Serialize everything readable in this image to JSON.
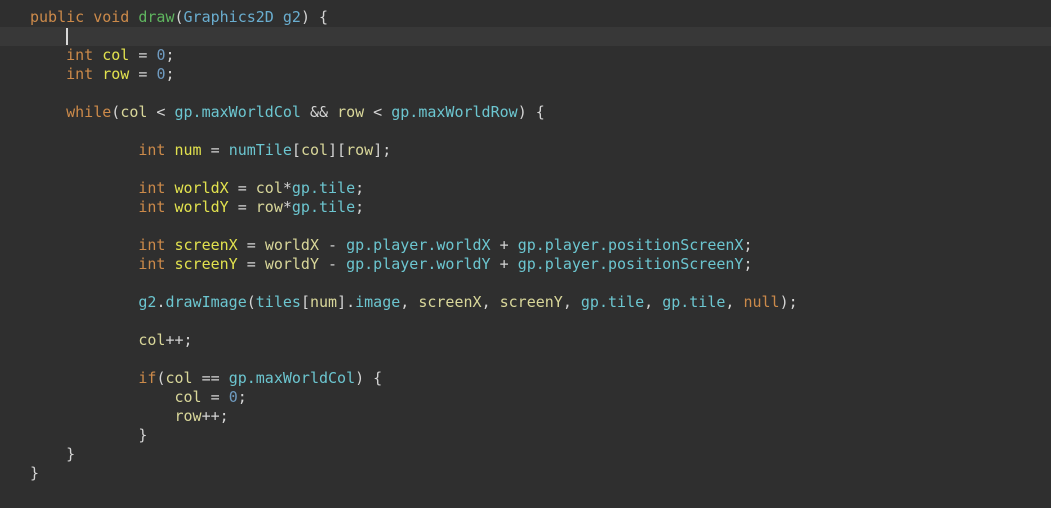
{
  "colors": {
    "background": "#2f2f2f",
    "current_line": "#383838",
    "keyword": "#cc8a4a",
    "type": "#6aaed0",
    "method": "#5fb55f",
    "local_decl": "#e2e24e",
    "local_use": "#d9d79a",
    "field": "#6cc6d0",
    "number": "#6f9bc0"
  },
  "code": {
    "current_line": 1,
    "lines": [
      {
        "indent": 0,
        "tokens": [
          {
            "t": "public void ",
            "k": "kw"
          },
          {
            "t": "draw",
            "k": "fn"
          },
          {
            "t": "(",
            "k": "p"
          },
          {
            "t": "Graphics2D g2",
            "k": "ty"
          },
          {
            "t": ") {",
            "k": "p"
          }
        ]
      },
      {
        "indent": 4,
        "tokens": []
      },
      {
        "indent": 4,
        "tokens": [
          {
            "t": "int ",
            "k": "kw"
          },
          {
            "t": "col",
            "k": "var"
          },
          {
            "t": " = ",
            "k": "p"
          },
          {
            "t": "0",
            "k": "num"
          },
          {
            "t": ";",
            "k": "p"
          }
        ]
      },
      {
        "indent": 4,
        "tokens": [
          {
            "t": "int ",
            "k": "kw"
          },
          {
            "t": "row",
            "k": "var"
          },
          {
            "t": " = ",
            "k": "p"
          },
          {
            "t": "0",
            "k": "num"
          },
          {
            "t": ";",
            "k": "p"
          }
        ]
      },
      {
        "indent": 0,
        "tokens": []
      },
      {
        "indent": 4,
        "tokens": [
          {
            "t": "while",
            "k": "kw"
          },
          {
            "t": "(",
            "k": "p"
          },
          {
            "t": "col",
            "k": "loc"
          },
          {
            "t": " < ",
            "k": "p"
          },
          {
            "t": "gp.maxWorldCol",
            "k": "fld"
          },
          {
            "t": " && ",
            "k": "p"
          },
          {
            "t": "row",
            "k": "loc"
          },
          {
            "t": " < ",
            "k": "p"
          },
          {
            "t": "gp.maxWorldRow",
            "k": "fld"
          },
          {
            "t": ") {",
            "k": "p"
          }
        ]
      },
      {
        "indent": 0,
        "tokens": []
      },
      {
        "indent": 12,
        "tokens": [
          {
            "t": "int ",
            "k": "kw"
          },
          {
            "t": "num",
            "k": "var"
          },
          {
            "t": " = ",
            "k": "p"
          },
          {
            "t": "numTile",
            "k": "fld"
          },
          {
            "t": "[",
            "k": "p"
          },
          {
            "t": "col",
            "k": "loc"
          },
          {
            "t": "][",
            "k": "p"
          },
          {
            "t": "row",
            "k": "loc"
          },
          {
            "t": "];",
            "k": "p"
          }
        ]
      },
      {
        "indent": 0,
        "tokens": []
      },
      {
        "indent": 12,
        "tokens": [
          {
            "t": "int ",
            "k": "kw"
          },
          {
            "t": "worldX",
            "k": "var"
          },
          {
            "t": " = ",
            "k": "p"
          },
          {
            "t": "col",
            "k": "loc"
          },
          {
            "t": "*",
            "k": "p"
          },
          {
            "t": "gp.tile",
            "k": "fld"
          },
          {
            "t": ";",
            "k": "p"
          }
        ]
      },
      {
        "indent": 12,
        "tokens": [
          {
            "t": "int ",
            "k": "kw"
          },
          {
            "t": "worldY",
            "k": "var"
          },
          {
            "t": " = ",
            "k": "p"
          },
          {
            "t": "row",
            "k": "loc"
          },
          {
            "t": "*",
            "k": "p"
          },
          {
            "t": "gp.tile",
            "k": "fld"
          },
          {
            "t": ";",
            "k": "p"
          }
        ]
      },
      {
        "indent": 0,
        "tokens": []
      },
      {
        "indent": 12,
        "tokens": [
          {
            "t": "int ",
            "k": "kw"
          },
          {
            "t": "screenX",
            "k": "var"
          },
          {
            "t": " = ",
            "k": "p"
          },
          {
            "t": "worldX",
            "k": "loc"
          },
          {
            "t": " - ",
            "k": "p"
          },
          {
            "t": "gp.player.worldX",
            "k": "fld"
          },
          {
            "t": " + ",
            "k": "p"
          },
          {
            "t": "gp.player.positionScreenX",
            "k": "fld"
          },
          {
            "t": ";",
            "k": "p"
          }
        ]
      },
      {
        "indent": 12,
        "tokens": [
          {
            "t": "int ",
            "k": "kw"
          },
          {
            "t": "screenY",
            "k": "var"
          },
          {
            "t": " = ",
            "k": "p"
          },
          {
            "t": "worldY",
            "k": "loc"
          },
          {
            "t": " - ",
            "k": "p"
          },
          {
            "t": "gp.player.worldY",
            "k": "fld"
          },
          {
            "t": " + ",
            "k": "p"
          },
          {
            "t": "gp.player.positionScreenY",
            "k": "fld"
          },
          {
            "t": ";",
            "k": "p"
          }
        ]
      },
      {
        "indent": 0,
        "tokens": []
      },
      {
        "indent": 12,
        "tokens": [
          {
            "t": "g2",
            "k": "fld"
          },
          {
            "t": ".",
            "k": "p"
          },
          {
            "t": "drawImage",
            "k": "fld"
          },
          {
            "t": "(",
            "k": "p"
          },
          {
            "t": "tiles",
            "k": "fld"
          },
          {
            "t": "[",
            "k": "p"
          },
          {
            "t": "num",
            "k": "loc"
          },
          {
            "t": "].",
            "k": "p"
          },
          {
            "t": "image",
            "k": "fld"
          },
          {
            "t": ", ",
            "k": "p"
          },
          {
            "t": "screenX",
            "k": "loc"
          },
          {
            "t": ", ",
            "k": "p"
          },
          {
            "t": "screenY",
            "k": "loc"
          },
          {
            "t": ", ",
            "k": "p"
          },
          {
            "t": "gp.tile",
            "k": "fld"
          },
          {
            "t": ", ",
            "k": "p"
          },
          {
            "t": "gp.tile",
            "k": "fld"
          },
          {
            "t": ", ",
            "k": "p"
          },
          {
            "t": "null",
            "k": "kw"
          },
          {
            "t": ");",
            "k": "p"
          }
        ]
      },
      {
        "indent": 0,
        "tokens": []
      },
      {
        "indent": 12,
        "tokens": [
          {
            "t": "col",
            "k": "loc"
          },
          {
            "t": "++;",
            "k": "p"
          }
        ]
      },
      {
        "indent": 0,
        "tokens": []
      },
      {
        "indent": 12,
        "tokens": [
          {
            "t": "if",
            "k": "kw"
          },
          {
            "t": "(",
            "k": "p"
          },
          {
            "t": "col",
            "k": "loc"
          },
          {
            "t": " == ",
            "k": "p"
          },
          {
            "t": "gp.maxWorldCol",
            "k": "fld"
          },
          {
            "t": ") {",
            "k": "p"
          }
        ]
      },
      {
        "indent": 16,
        "tokens": [
          {
            "t": "col",
            "k": "loc"
          },
          {
            "t": " = ",
            "k": "p"
          },
          {
            "t": "0",
            "k": "num"
          },
          {
            "t": ";",
            "k": "p"
          }
        ]
      },
      {
        "indent": 16,
        "tokens": [
          {
            "t": "row",
            "k": "loc"
          },
          {
            "t": "++;",
            "k": "p"
          }
        ]
      },
      {
        "indent": 12,
        "tokens": [
          {
            "t": "}",
            "k": "p"
          }
        ]
      },
      {
        "indent": 4,
        "tokens": [
          {
            "t": "}",
            "k": "p"
          }
        ]
      },
      {
        "indent": 0,
        "tokens": [
          {
            "t": "}",
            "k": "p"
          }
        ]
      }
    ]
  }
}
